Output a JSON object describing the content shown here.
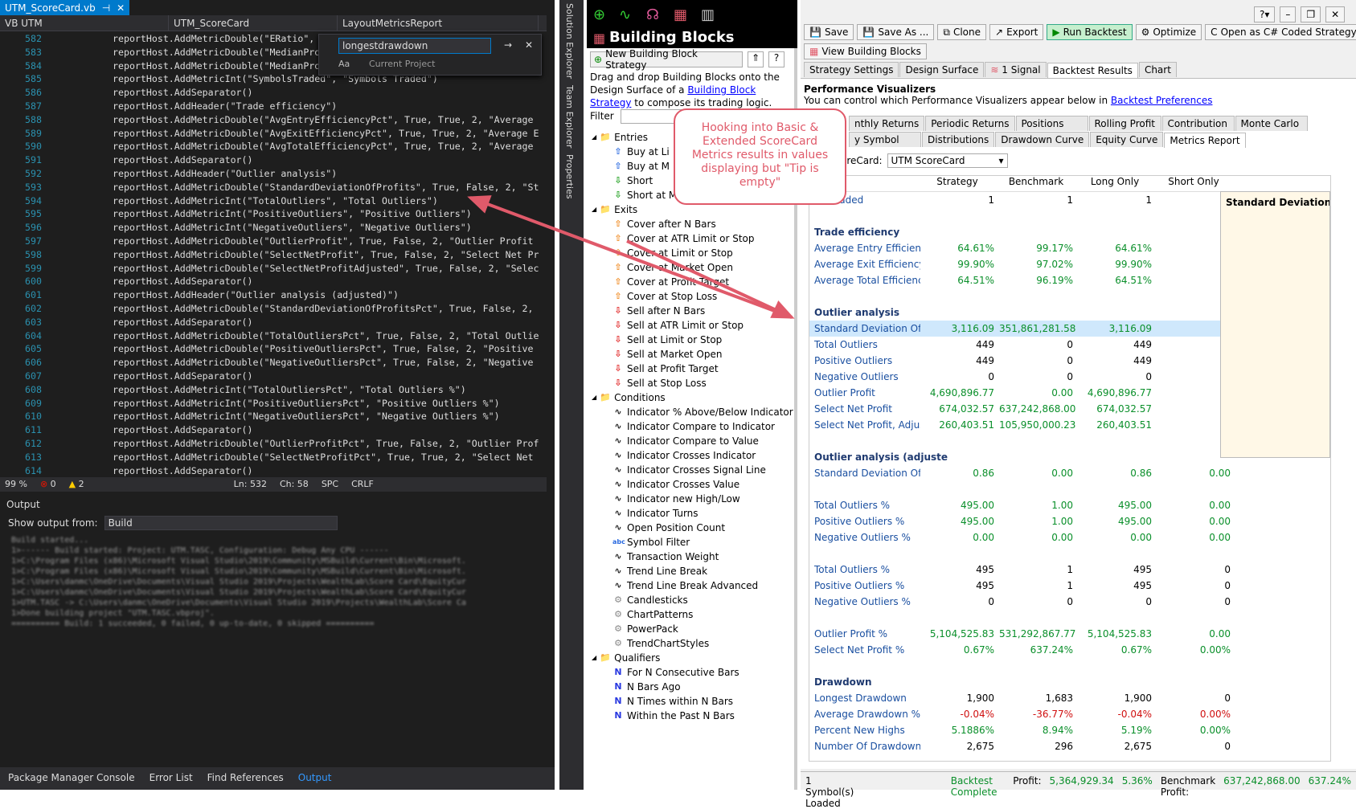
{
  "vs": {
    "tab_title": "UTM_ScoreCard.vb",
    "nav": [
      "VB UTM",
      "UTM_ScoreCard",
      "LayoutMetricsReport"
    ],
    "find_text": "longestdrawdown",
    "find_scope": "Current Project",
    "code_lines": [
      {
        "n": "582",
        "t": "reportHost.AddMetricDouble(\"ERatio\","
      },
      {
        "n": "583",
        "t": "reportHost.AddMetricDouble(\"MedianPro"
      },
      {
        "n": "584",
        "t": "reportHost.AddMetricDouble(\"MedianPro"
      },
      {
        "n": "585",
        "t": "reportHost.AddMetricInt(\"SymbolsTraded\", \"Symbols Traded\")"
      },
      {
        "n": "586",
        "t": "reportHost.AddSeparator()"
      },
      {
        "n": "587",
        "t": "reportHost.AddHeader(\"Trade efficiency\")"
      },
      {
        "n": "588",
        "t": "reportHost.AddMetricDouble(\"AvgEntryEfficiencyPct\", True, True, 2, \"Average"
      },
      {
        "n": "589",
        "t": "reportHost.AddMetricDouble(\"AvgExitEfficiencyPct\", True, True, 2, \"Average E"
      },
      {
        "n": "590",
        "t": "reportHost.AddMetricDouble(\"AvgTotalEfficiencyPct\", True, True, 2, \"Average"
      },
      {
        "n": "591",
        "t": "reportHost.AddSeparator()"
      },
      {
        "n": "592",
        "t": "reportHost.AddHeader(\"Outlier analysis\")"
      },
      {
        "n": "593",
        "t": "reportHost.AddMetricDouble(\"StandardDeviationOfProfits\", True, False, 2, \"St"
      },
      {
        "n": "594",
        "t": "reportHost.AddMetricInt(\"TotalOutliers\", \"Total Outliers\")"
      },
      {
        "n": "595",
        "t": "reportHost.AddMetricInt(\"PositiveOutliers\", \"Positive Outliers\")"
      },
      {
        "n": "596",
        "t": "reportHost.AddMetricInt(\"NegativeOutliers\", \"Negative Outliers\")"
      },
      {
        "n": "597",
        "t": "reportHost.AddMetricDouble(\"OutlierProfit\", True, False, 2, \"Outlier Profit"
      },
      {
        "n": "598",
        "t": "reportHost.AddMetricDouble(\"SelectNetProfit\", True, False, 2, \"Select Net Pr"
      },
      {
        "n": "599",
        "t": "reportHost.AddMetricDouble(\"SelectNetProfitAdjusted\", True, False, 2, \"Selec"
      },
      {
        "n": "600",
        "t": "reportHost.AddSeparator()"
      },
      {
        "n": "601",
        "t": "reportHost.AddHeader(\"Outlier analysis (adjusted)\")"
      },
      {
        "n": "602",
        "t": "reportHost.AddMetricDouble(\"StandardDeviationOfProfitsPct\", True, False, 2,"
      },
      {
        "n": "603",
        "t": "reportHost.AddSeparator()"
      },
      {
        "n": "604",
        "t": "reportHost.AddMetricDouble(\"TotalOutliersPct\", True, False, 2, \"Total Outlie"
      },
      {
        "n": "605",
        "t": "reportHost.AddMetricDouble(\"PositiveOutliersPct\", True, False, 2, \"Positive"
      },
      {
        "n": "606",
        "t": "reportHost.AddMetricDouble(\"NegativeOutliersPct\", True, False, 2, \"Negative"
      },
      {
        "n": "607",
        "t": "reportHost.AddSeparator()"
      },
      {
        "n": "608",
        "t": "reportHost.AddMetricInt(\"TotalOutliersPct\", \"Total Outliers %\")"
      },
      {
        "n": "609",
        "t": "reportHost.AddMetricInt(\"PositiveOutliersPct\", \"Positive Outliers %\")"
      },
      {
        "n": "610",
        "t": "reportHost.AddMetricInt(\"NegativeOutliersPct\", \"Negative Outliers %\")"
      },
      {
        "n": "611",
        "t": "reportHost.AddSeparator()"
      },
      {
        "n": "612",
        "t": "reportHost.AddMetricDouble(\"OutlierProfitPct\", True, False, 2, \"Outlier Prof"
      },
      {
        "n": "613",
        "t": "reportHost.AddMetricDouble(\"SelectNetProfitPct\", True, True, 2, \"Select Net"
      },
      {
        "n": "614",
        "t": "reportHost.AddSeparator()"
      }
    ],
    "status": {
      "zoom": "99 %",
      "errors": "0",
      "warnings": "2",
      "ln": "Ln: 532",
      "ch": "Ch: 58",
      "spc": "SPC",
      "crlf": "CRLF"
    },
    "output_title": "Output",
    "output_from_label": "Show output from:",
    "output_from_value": "Build",
    "output_lines": [
      "Build started...",
      "1>------ Build started: Project: UTM.TASC, Configuration: Debug Any CPU ------",
      "1>C:\\Program Files (x86)\\Microsoft Visual Studio\\2019\\Community\\MSBuild\\Current\\Bin\\Microsoft.",
      "1>C:\\Program Files (x86)\\Microsoft Visual Studio\\2019\\Community\\MSBuild\\Current\\Bin\\Microsoft.",
      "1>C:\\Users\\danmc\\OneDrive\\Documents\\Visual Studio 2019\\Projects\\WealthLab\\Score Card\\EquityCur",
      "1>C:\\Users\\danmc\\OneDrive\\Documents\\Visual Studio 2019\\Projects\\WealthLab\\Score Card\\EquityCur",
      "1>UTM.TASC -> C:\\Users\\danmc\\OneDrive\\Documents\\Visual Studio 2019\\Projects\\WealthLab\\Score Ca",
      "1>Done building project \"UTM.TASC.vbproj\".",
      "========== Build: 1 succeeded, 0 failed, 0 up-to-date, 0 skipped =========="
    ],
    "bottom_tabs": [
      "Package Manager Console",
      "Error List",
      "Find References",
      "Output"
    ],
    "side_tabs": [
      "Solution Explorer",
      "Team Explorer",
      "Properties"
    ]
  },
  "bb": {
    "title": "Building Blocks",
    "new_button": "New Building Block Strategy",
    "desc1": "Drag and drop Building Blocks onto the Design Surface of a ",
    "desc_link": "Building Block Strategy",
    "desc2": " to compose its trading logic.",
    "filter_label": "Filter",
    "tree": [
      {
        "t": "Entries",
        "k": "folder",
        "lvl": 0
      },
      {
        "t": "Buy at Li",
        "k": "up-blue",
        "lvl": 1
      },
      {
        "t": "Buy at M",
        "k": "up-blue",
        "lvl": 1
      },
      {
        "t": "Short",
        "k": "down-green",
        "lvl": 1
      },
      {
        "t": "Short at M",
        "k": "down-green",
        "lvl": 1
      },
      {
        "t": "Exits",
        "k": "folder",
        "lvl": 0
      },
      {
        "t": "Cover after N Bars",
        "k": "up-orange",
        "lvl": 1
      },
      {
        "t": "Cover at ATR Limit or Stop",
        "k": "up-orange",
        "lvl": 1
      },
      {
        "t": "Cover at Limit or Stop",
        "k": "up-orange",
        "lvl": 1
      },
      {
        "t": "Cover at Market Open",
        "k": "up-orange",
        "lvl": 1
      },
      {
        "t": "Cover at Profit Target",
        "k": "up-orange",
        "lvl": 1
      },
      {
        "t": "Cover at Stop Loss",
        "k": "up-orange",
        "lvl": 1
      },
      {
        "t": "Sell after N Bars",
        "k": "down-red",
        "lvl": 1
      },
      {
        "t": "Sell at ATR Limit or Stop",
        "k": "down-red",
        "lvl": 1
      },
      {
        "t": "Sell at Limit or Stop",
        "k": "down-red",
        "lvl": 1
      },
      {
        "t": "Sell at Market Open",
        "k": "down-red",
        "lvl": 1
      },
      {
        "t": "Sell at Profit Target",
        "k": "down-red",
        "lvl": 1
      },
      {
        "t": "Sell at Stop Loss",
        "k": "down-red",
        "lvl": 1
      },
      {
        "t": "Conditions",
        "k": "folder",
        "lvl": 0
      },
      {
        "t": "Indicator % Above/Below Indicator",
        "k": "wave",
        "lvl": 1
      },
      {
        "t": "Indicator Compare to Indicator",
        "k": "wave",
        "lvl": 1
      },
      {
        "t": "Indicator Compare to Value",
        "k": "wave",
        "lvl": 1
      },
      {
        "t": "Indicator Crosses Indicator",
        "k": "wave",
        "lvl": 1
      },
      {
        "t": "Indicator Crosses Signal Line",
        "k": "wave",
        "lvl": 1
      },
      {
        "t": "Indicator Crosses Value",
        "k": "wave",
        "lvl": 1
      },
      {
        "t": "Indicator new High/Low",
        "k": "wave",
        "lvl": 1
      },
      {
        "t": "Indicator Turns",
        "k": "wave",
        "lvl": 1
      },
      {
        "t": "Open Position Count",
        "k": "wave",
        "lvl": 1
      },
      {
        "t": "Symbol Filter",
        "k": "abc",
        "lvl": 1
      },
      {
        "t": "Transaction Weight",
        "k": "wave",
        "lvl": 1
      },
      {
        "t": "Trend Line Break",
        "k": "wave",
        "lvl": 1
      },
      {
        "t": "Trend Line Break Advanced",
        "k": "wave",
        "lvl": 1
      },
      {
        "t": "Candlesticks",
        "k": "gear",
        "lvl": 1
      },
      {
        "t": "ChartPatterns",
        "k": "gear",
        "lvl": 1
      },
      {
        "t": "PowerPack",
        "k": "gear",
        "lvl": 1
      },
      {
        "t": "TrendChartStyles",
        "k": "gear",
        "lvl": 1
      },
      {
        "t": "Qualifiers",
        "k": "folder",
        "lvl": 0
      },
      {
        "t": "For N Consecutive Bars",
        "k": "n",
        "lvl": 1
      },
      {
        "t": "N Bars Ago",
        "k": "n",
        "lvl": 1
      },
      {
        "t": "N Times within N Bars",
        "k": "n",
        "lvl": 1
      },
      {
        "t": "Within the Past N Bars",
        "k": "n",
        "lvl": 1
      }
    ]
  },
  "wl": {
    "toolbar": [
      "Save",
      "Save As ...",
      "Clone",
      "Export",
      "Run Backtest",
      "Optimize",
      "Open as C# Coded Strategy"
    ],
    "view_bb": "View Building Blocks",
    "main_tabs": [
      "Strategy Settings",
      "Design Surface",
      "1 Signal",
      "Backtest Results",
      "Chart"
    ],
    "perf_title": "Performance Visualizers",
    "perf_desc": "You can control which Performance Visualizers appear below in ",
    "perf_link": "Backtest Preferences",
    "viz_tabs1": [
      "nthly Returns",
      "Periodic Returns",
      "Positions",
      "Rolling Profit",
      "Contribution",
      "Monte Carlo"
    ],
    "viz_tabs2": [
      "y Symbol",
      "Distributions",
      "Drawdown Curve",
      "Equity Curve",
      "Metrics Report"
    ],
    "scorecard_label": "oreCard:",
    "scorecard_value": "UTM ScoreCard",
    "cols": [
      "",
      "Strategy",
      "Benchmark",
      "Long Only",
      "Short Only"
    ],
    "rows": [
      {
        "s": false,
        "l": "ols Traded",
        "v": [
          "1",
          "1",
          "1",
          ""
        ],
        "c": "blk"
      },
      {
        "s": false,
        "l": "",
        "v": [
          "",
          "",
          "",
          ""
        ],
        "c": "blk"
      },
      {
        "s": true,
        "l": "Trade efficiency"
      },
      {
        "s": false,
        "l": "Average Entry Efficiency",
        "v": [
          "64.61%",
          "99.17%",
          "64.61%",
          "0"
        ],
        "c": "grn"
      },
      {
        "s": false,
        "l": "Average Exit Efficiency %",
        "v": [
          "99.90%",
          "97.02%",
          "99.90%",
          "0"
        ],
        "c": "grn"
      },
      {
        "s": false,
        "l": "Average Total Efficiency",
        "v": [
          "64.51%",
          "96.19%",
          "64.51%",
          "0"
        ],
        "c": "grn"
      },
      {
        "s": false,
        "l": "",
        "v": [
          "",
          "",
          "",
          ""
        ],
        "c": "blk"
      },
      {
        "s": true,
        "l": "Outlier analysis"
      },
      {
        "s": false,
        "l": "Standard Deviation Of Pr",
        "v": [
          "3,116.09",
          "351,861,281.58",
          "3,116.09",
          ""
        ],
        "c": "grn",
        "sel": true
      },
      {
        "s": false,
        "l": "Total Outliers",
        "v": [
          "449",
          "0",
          "449",
          ""
        ],
        "c": "blk"
      },
      {
        "s": false,
        "l": "Positive Outliers",
        "v": [
          "449",
          "0",
          "449",
          ""
        ],
        "c": "blk"
      },
      {
        "s": false,
        "l": "Negative Outliers",
        "v": [
          "0",
          "0",
          "0",
          ""
        ],
        "c": "blk"
      },
      {
        "s": false,
        "l": "Outlier Profit",
        "v": [
          "4,690,896.77",
          "0.00",
          "4,690,896.77",
          ""
        ],
        "c": "grn"
      },
      {
        "s": false,
        "l": "Select Net Profit",
        "v": [
          "674,032.57",
          "637,242,868.00",
          "674,032.57",
          ""
        ],
        "c": "grn"
      },
      {
        "s": false,
        "l": "Select Net Profit, Adjuste",
        "v": [
          "260,403.51",
          "105,950,000.23",
          "260,403.51",
          ""
        ],
        "c": "grn"
      },
      {
        "s": false,
        "l": "",
        "v": [
          "",
          "",
          "",
          ""
        ],
        "c": "blk"
      },
      {
        "s": true,
        "l": "Outlier analysis (adjuste"
      },
      {
        "s": false,
        "l": "Standard Deviation Of Pr",
        "v": [
          "0.86",
          "0.00",
          "0.86",
          "0.00"
        ],
        "c": "grn"
      },
      {
        "s": false,
        "l": "",
        "v": [
          "",
          "",
          "",
          ""
        ],
        "c": "blk"
      },
      {
        "s": false,
        "l": "Total Outliers %",
        "v": [
          "495.00",
          "1.00",
          "495.00",
          "0.00"
        ],
        "c": "grn"
      },
      {
        "s": false,
        "l": "Positive Outliers %",
        "v": [
          "495.00",
          "1.00",
          "495.00",
          "0.00"
        ],
        "c": "grn"
      },
      {
        "s": false,
        "l": "Negative Outliers %",
        "v": [
          "0.00",
          "0.00",
          "0.00",
          "0.00"
        ],
        "c": "grn"
      },
      {
        "s": false,
        "l": "",
        "v": [
          "",
          "",
          "",
          ""
        ],
        "c": "blk"
      },
      {
        "s": false,
        "l": "Total Outliers %",
        "v": [
          "495",
          "1",
          "495",
          "0"
        ],
        "c": "blk"
      },
      {
        "s": false,
        "l": "Positive Outliers %",
        "v": [
          "495",
          "1",
          "495",
          "0"
        ],
        "c": "blk"
      },
      {
        "s": false,
        "l": "Negative Outliers %",
        "v": [
          "0",
          "0",
          "0",
          "0"
        ],
        "c": "blk"
      },
      {
        "s": false,
        "l": "",
        "v": [
          "",
          "",
          "",
          ""
        ],
        "c": "blk"
      },
      {
        "s": false,
        "l": "Outlier Profit %",
        "v": [
          "5,104,525.83",
          "531,292,867.77",
          "5,104,525.83",
          "0.00"
        ],
        "c": "grn"
      },
      {
        "s": false,
        "l": "Select Net Profit %",
        "v": [
          "0.67%",
          "637.24%",
          "0.67%",
          "0.00%"
        ],
        "c": "grn"
      },
      {
        "s": false,
        "l": "",
        "v": [
          "",
          "",
          "",
          ""
        ],
        "c": "blk"
      },
      {
        "s": true,
        "l": "Drawdown"
      },
      {
        "s": false,
        "l": "Longest Drawdown",
        "v": [
          "1,900",
          "1,683",
          "1,900",
          "0"
        ],
        "c": "blk"
      },
      {
        "s": false,
        "l": "Average Drawdown %",
        "v": [
          "-0.04%",
          "-36.77%",
          "-0.04%",
          "0.00%"
        ],
        "c": "red"
      },
      {
        "s": false,
        "l": "Percent New Highs",
        "v": [
          "5.1886%",
          "8.94%",
          "5.19%",
          "0.00%"
        ],
        "c": "grn"
      },
      {
        "s": false,
        "l": "Number Of Drawdowns",
        "v": [
          "2,675",
          "296",
          "2,675",
          "0"
        ],
        "c": "blk"
      }
    ],
    "tip_text": "Standard Deviation Of P",
    "status": {
      "loaded": "1 Symbol(s) Loaded",
      "complete": "Backtest Complete",
      "profit_label": "Profit:",
      "profit": "5,364,929.34",
      "profit_pct": "5.36%",
      "bench_label": "Benchmark Profit:",
      "bench": "637,242,868.00",
      "bench_pct": "637.24%"
    }
  },
  "callout": "Hooking into Basic & Extended ScoreCard Metrics results in values displaying but \"Tip is empty\"",
  "colors": {
    "vs_blue": "#007acc",
    "callout": "#e05a6a",
    "green": "#0a8f2a",
    "red": "#d01010"
  }
}
